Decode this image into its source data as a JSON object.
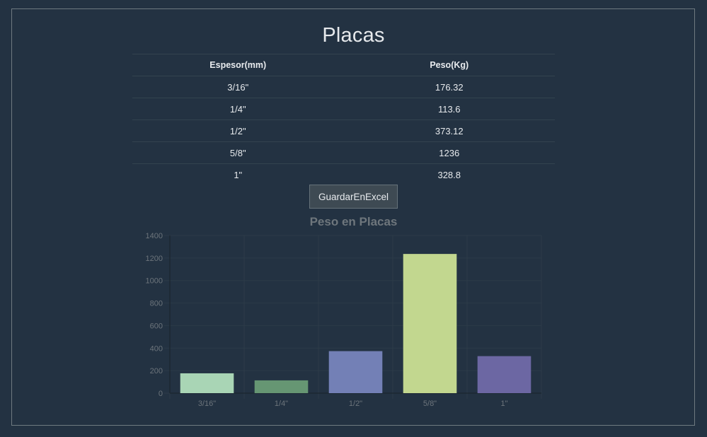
{
  "page": {
    "title": "Placas"
  },
  "table": {
    "headers": [
      "Espesor(mm)",
      "Peso(Kg)"
    ],
    "rows": [
      [
        "3/16\"",
        "176.32"
      ],
      [
        "1/4\"",
        "113.6"
      ],
      [
        "1/2\"",
        "373.12"
      ],
      [
        "5/8\"",
        "1236"
      ],
      [
        "1\"",
        "328.8"
      ]
    ]
  },
  "actions": {
    "export_label": "GuardarEnExcel"
  },
  "chart_data": {
    "type": "bar",
    "title": "Peso en Placas",
    "categories": [
      "3/16\"",
      "1/4\"",
      "1/2\"",
      "5/8\"",
      "1\""
    ],
    "values": [
      176.32,
      113.6,
      373.12,
      1236,
      328.8
    ],
    "colors": [
      "#a9d5b5",
      "#669673",
      "#7380b6",
      "#c2d78f",
      "#6c67a3"
    ],
    "ylim": [
      0,
      1400
    ],
    "yticks": [
      0,
      200,
      400,
      600,
      800,
      1000,
      1200,
      1400
    ],
    "grid": true,
    "xlabel": "",
    "ylabel": ""
  }
}
